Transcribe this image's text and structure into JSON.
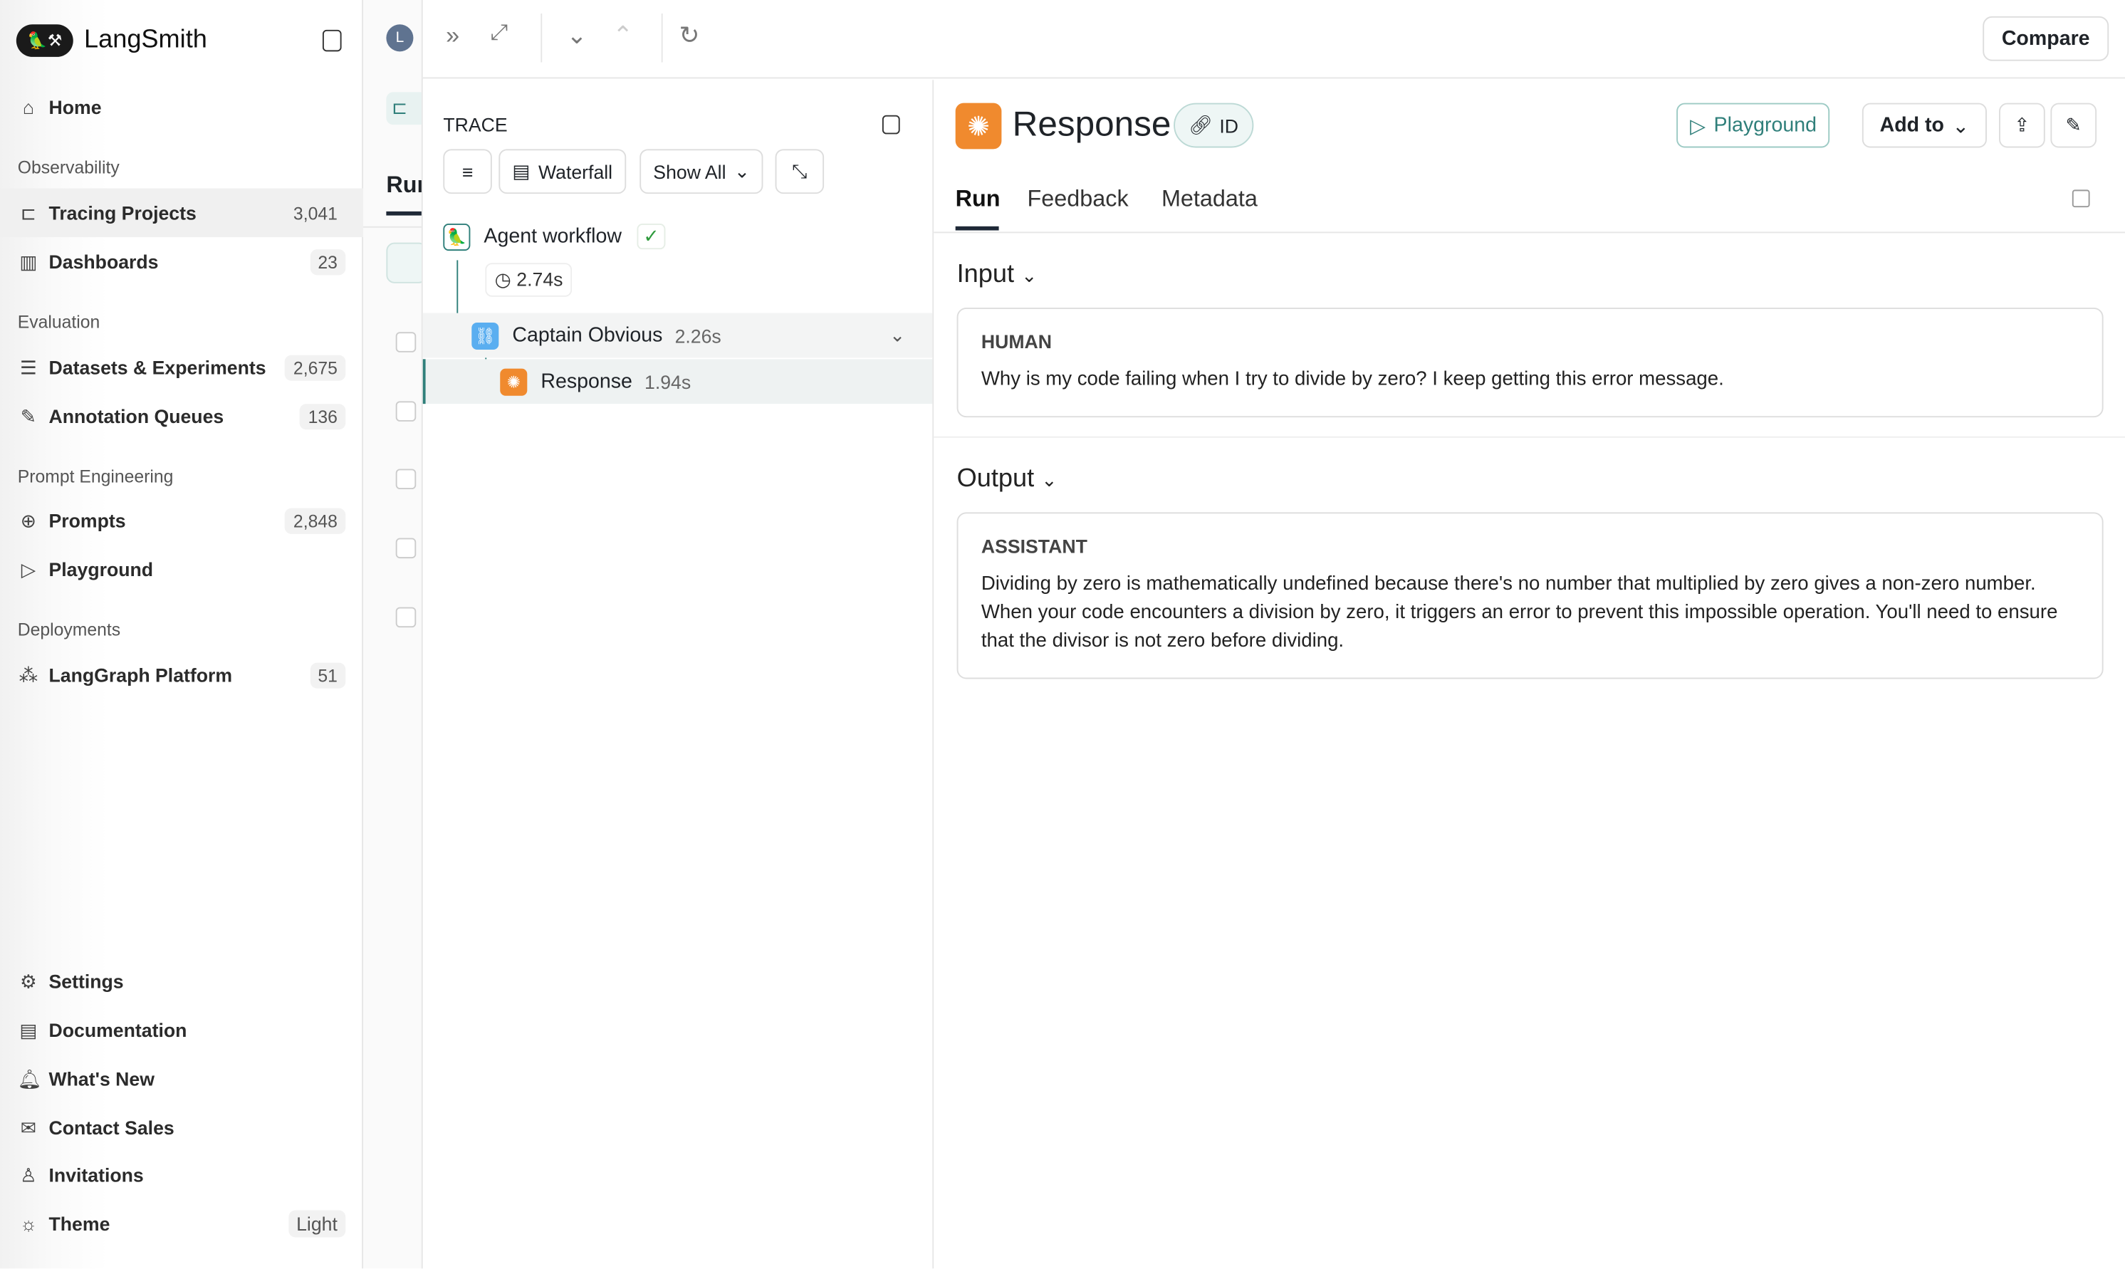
{
  "app": {
    "name": "LangSmith"
  },
  "sidebar": {
    "home": "Home",
    "sections": [
      "Observability",
      "Evaluation",
      "Prompt Engineering",
      "Deployments"
    ],
    "items": [
      {
        "label": "Tracing Projects",
        "count": "3,041",
        "icon": "tracing-icon"
      },
      {
        "label": "Dashboards",
        "count": "23",
        "icon": "bar-chart-icon"
      },
      {
        "label": "Datasets & Experiments",
        "count": "2,675",
        "icon": "database-icon"
      },
      {
        "label": "Annotation Queues",
        "count": "136",
        "icon": "pen-icon"
      },
      {
        "label": "Prompts",
        "count": "2,848",
        "icon": "prompt-icon"
      },
      {
        "label": "Playground",
        "icon": "play-icon"
      },
      {
        "label": "LangGraph Platform",
        "count": "51",
        "icon": "graph-icon"
      }
    ],
    "bottom": [
      {
        "label": "Settings",
        "icon": "gear-icon"
      },
      {
        "label": "Documentation",
        "icon": "doc-icon"
      },
      {
        "label": "What's New",
        "icon": "bell-icon"
      },
      {
        "label": "Contact Sales",
        "icon": "mail-icon"
      },
      {
        "label": "Invitations",
        "icon": "user-plus-icon"
      },
      {
        "label": "Theme",
        "value": "Light",
        "icon": "sun-icon"
      }
    ]
  },
  "midstrip": {
    "avatar": "L",
    "tab": "Run"
  },
  "topbar": {
    "compare": "Compare"
  },
  "trace": {
    "title": "TRACE",
    "waterfall": "Waterfall",
    "show_all": "Show All",
    "nodes": [
      {
        "name": "Agent workflow",
        "duration": "2.74s",
        "status": "success"
      },
      {
        "name": "Captain Obvious",
        "duration": "2.26s"
      },
      {
        "name": "Response",
        "duration": "1.94s"
      }
    ]
  },
  "detail": {
    "title": "Response",
    "id_label": "ID",
    "playground": "Playground",
    "add_to": "Add to",
    "tabs": [
      "Run",
      "Feedback",
      "Metadata"
    ],
    "input": {
      "heading": "Input",
      "role": "HUMAN",
      "text": "Why is my code failing when I try to divide by zero? I keep getting this error message."
    },
    "output": {
      "heading": "Output",
      "role": "ASSISTANT",
      "text": "Dividing by zero is mathematically undefined because there's no number that multiplied by zero gives a non-zero number. When your code encounters a division by zero, it triggers an error to prevent this impossible operation. You'll need to ensure that the divisor is not zero before dividing."
    }
  },
  "colors": {
    "accent": "#2f7f7a",
    "orange": "#f08a2e",
    "blue": "#5aaef0"
  }
}
